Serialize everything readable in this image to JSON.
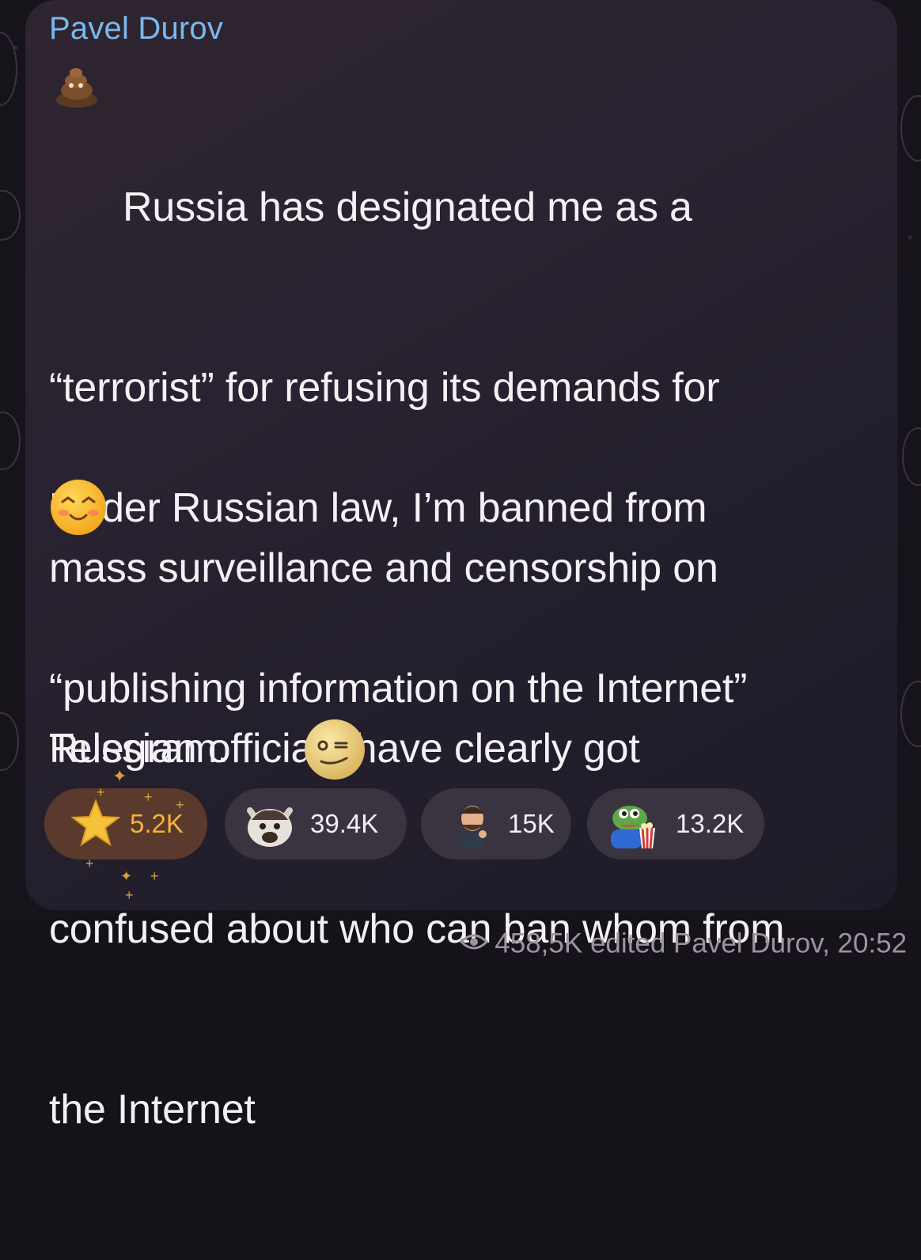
{
  "message": {
    "author": "Pavel Durov",
    "paragraph1": [
      "Russia has designated me as a",
      "“terrorist” for refusing its demands for",
      "mass surveillance and censorship on",
      "Telegram."
    ],
    "paragraph2": [
      "Under Russian law, I’m banned from",
      "“publishing information on the Internet”"
    ],
    "paragraph3": [
      "Russian officials have clearly got",
      "confused about who can ban whom from",
      "the Internet"
    ]
  },
  "reactions": [
    {
      "icon": "star-icon",
      "count": "5.2K"
    },
    {
      "icon": "cat-icon",
      "count": "39.4K"
    },
    {
      "icon": "man-thinking-icon",
      "count": "15K"
    },
    {
      "icon": "frog-popcorn-icon",
      "count": "13.2K"
    }
  ],
  "footer": {
    "views": "458,5K",
    "status": "edited Pavel Durov, 20:52"
  }
}
